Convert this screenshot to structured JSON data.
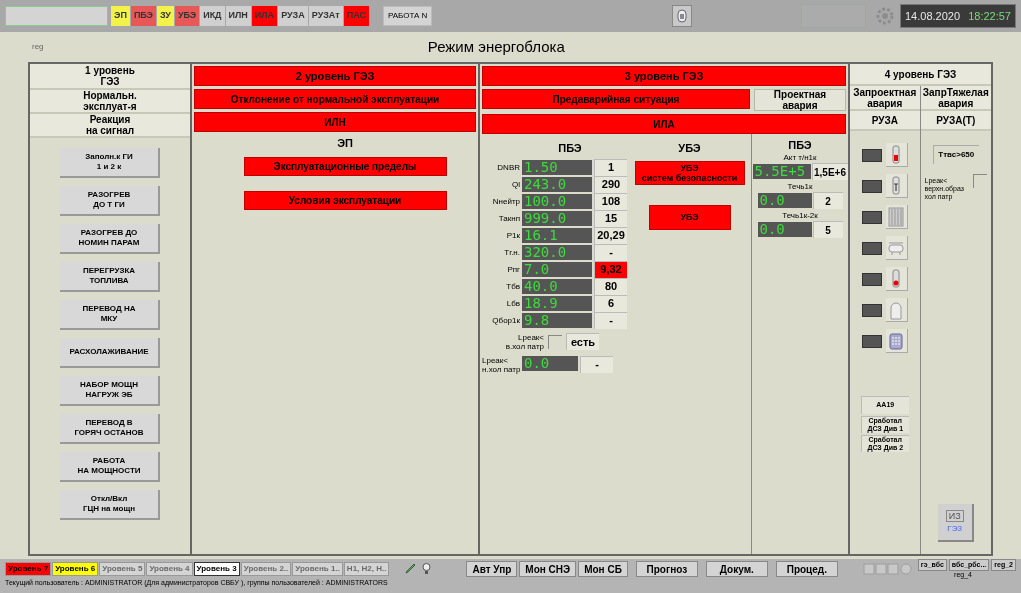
{
  "top_bar": {
    "indicators": [
      {
        "label": "ЭП",
        "color": "#f2f24a"
      },
      {
        "label": "ПБЭ",
        "color": "#e85858"
      },
      {
        "label": "ЗУ",
        "color": "#f2f24a"
      },
      {
        "label": "УБЭ",
        "color": "#e85858"
      },
      {
        "label": "ИКД",
        "color": "#d0d0d0"
      },
      {
        "label": "ИЛН",
        "color": "#d0d0d0"
      },
      {
        "label": "ИЛА",
        "color": "#ff0000"
      },
      {
        "label": "РУЗА",
        "color": "#d0d0d0"
      },
      {
        "label": "РУЗАт",
        "color": "#d0d0d0"
      },
      {
        "label": "ПАС",
        "color": "#ff0000"
      }
    ],
    "work_button": "РАБОТА N",
    "date": "14.08.2020",
    "time": "18:22:57"
  },
  "page": {
    "tag": "reg",
    "title": "Режим энергоблока"
  },
  "level1": {
    "title": "1 уровень\nГЭЗ",
    "rows": [
      "Нормальн.\nэксплуат-я",
      "Реакция\nна сигнал"
    ],
    "buttons": [
      "Заполн.к ГИ\n1 и 2 к",
      "РАЗОГРЕВ\nДО Т ГИ",
      "РАЗОГРЕВ ДО\nНОМИН ПАРАМ",
      "ПЕРЕГРУЗКА\nТОПЛИВА",
      "ПЕРЕВОД НА\nМКУ",
      "РАСХОЛАЖИВАНИЕ",
      "НАБОР МОЩН\nНАГРУЖ ЭБ",
      "ПЕРЕВОД В\nГОРЯЧ ОСТАНОВ",
      "РАБОТА\nНА МОЩНОСТИ",
      "Откл/Вкл\nГЦН на мощн"
    ]
  },
  "level2": {
    "title": {
      "label": "2 уровень ГЭЗ",
      "alarm": true
    },
    "rows": [
      {
        "label": "Отклонение от нормальной эксплуатации",
        "alarm": true
      },
      {
        "label": "ИЛН",
        "alarm": true
      }
    ],
    "section": "ЭП",
    "buttons": [
      {
        "label": "Эксплуатационные пределы",
        "alarm": true
      },
      {
        "label": "Условия эксплуатации",
        "alarm": true
      }
    ]
  },
  "level3": {
    "title": {
      "label": "3 уровень ГЭЗ",
      "alarm": true
    },
    "row1": [
      {
        "label": "Предаварийная ситуация",
        "alarm": true
      },
      {
        "label": "Проектная\nавария",
        "alarm": false
      }
    ],
    "row2": {
      "label": "ИЛА",
      "alarm": true
    },
    "pbe": {
      "title": "ПБЭ",
      "params": [
        {
          "kind": "value",
          "label": "DNBR",
          "value": "1.50",
          "limit": "1",
          "alarm": false
        },
        {
          "kind": "value",
          "label": "Ql",
          "value": "243.0",
          "limit": "290",
          "alarm": false
        },
        {
          "kind": "value",
          "label": "Nнейтр",
          "value": "100.0",
          "limit": "108",
          "alarm": false
        },
        {
          "kind": "value",
          "label": "Такнп",
          "value": "999.0",
          "limit": "15",
          "alarm": false
        },
        {
          "kind": "value",
          "label": "P1к",
          "value": "16.1",
          "limit": "20,29",
          "alarm": false
        },
        {
          "kind": "value",
          "label": "Тг.н.",
          "value": "320.0",
          "limit": "-",
          "alarm": false
        },
        {
          "kind": "value",
          "label": "Рпг",
          "value": "7.0",
          "limit": "9,32",
          "alarm": true
        },
        {
          "kind": "value",
          "label": "Тбв",
          "value": "40.0",
          "limit": "80",
          "alarm": false
        },
        {
          "kind": "value",
          "label": "Lбв",
          "value": "18.9",
          "limit": "6",
          "alarm": false
        },
        {
          "kind": "value",
          "label": "Qбор1к",
          "value": "9.8",
          "limit": "-",
          "alarm": false
        },
        {
          "kind": "checkbox",
          "label": "Lреак<\nв.хол патр",
          "checked": false,
          "limit": "есть",
          "alarm": false
        },
        {
          "kind": "value_wide",
          "label": "Lреак<\nн.хол патр",
          "value": "0.0",
          "limit": "-",
          "alarm": false
        }
      ]
    },
    "ube": {
      "title": "УБЭ",
      "buttons": [
        {
          "label": "УБЭ\nсистем безопасности",
          "alarm": true
        },
        {
          "label": "УБЭ",
          "alarm": true
        }
      ]
    },
    "pbe_right": {
      "title": "ПБЭ",
      "params": [
        {
          "label": "Акт т/н1к",
          "value": "5.5E+5",
          "limit": "1,5E+6"
        },
        {
          "label": "Течь1к",
          "value": "0.0",
          "limit": "2"
        },
        {
          "label": "Течь1к-2к",
          "value": "0.0",
          "limit": "5"
        }
      ]
    }
  },
  "level4": {
    "title": "4 уровень ГЭЗ",
    "columns": [
      {
        "title": "Запроектная\nавария",
        "sub": "РУЗА"
      },
      {
        "title": "ЗапрТяжелая\nавария",
        "sub": "РУЗА(Т)"
      }
    ],
    "ruza_indicators": [
      {
        "kind": "thermo_red"
      },
      {
        "kind": "thermo_t"
      },
      {
        "kind": "grille"
      },
      {
        "kind": "tank"
      },
      {
        "kind": "thermo_drop"
      },
      {
        "kind": "dome"
      },
      {
        "kind": "drum"
      }
    ],
    "aa": "AA19",
    "dsz": [
      "Сработал\nДСЗ Див 1",
      "Сработал\nДСЗ Див 2"
    ],
    "ttvs": "Tтвс>650",
    "lreak": {
      "label": "Lреак<\nверхн.образ\nхол патр",
      "checked": false
    },
    "gez_button": {
      "icon_text": "ИЗ",
      "label": "ГЭЗ"
    }
  },
  "bottom_bar": {
    "levels": [
      {
        "label": "Уровень 7",
        "color": "#ff0000",
        "disabled": false,
        "selected": false
      },
      {
        "label": "Уровень 6",
        "color": "#ffff00",
        "disabled": false,
        "selected": false
      },
      {
        "label": "Уровень 5",
        "color": "#d4d4d4",
        "disabled": true,
        "selected": false
      },
      {
        "label": "Уровень 4",
        "color": "#d4d4d4",
        "disabled": true,
        "selected": false
      },
      {
        "label": "Уровень 3",
        "color": "#ffffff",
        "disabled": false,
        "selected": true
      },
      {
        "label": "Уровень 2..",
        "color": "#d4d4d4",
        "disabled": true,
        "selected": false
      },
      {
        "label": "Уровень 1..",
        "color": "#d4d4d4",
        "disabled": true,
        "selected": false
      },
      {
        "label": "Н1, Н2, Н..",
        "color": "#d4d4d4",
        "disabled": true,
        "selected": false
      }
    ],
    "buttons": [
      "Авт Упр",
      "Мон СНЭ",
      "Мон СБ",
      "Прогноз",
      "Докум.",
      "Процед."
    ],
    "small_buttons": [
      "гэ_вбс",
      "вбс_рбс...",
      "reg_2"
    ],
    "page_tag": "reg_4",
    "status": "Текущий пользователь : ADMINISTRATOR (Для администраторов СВБУ ), группы пользователей : ADMINISTRATORS"
  }
}
